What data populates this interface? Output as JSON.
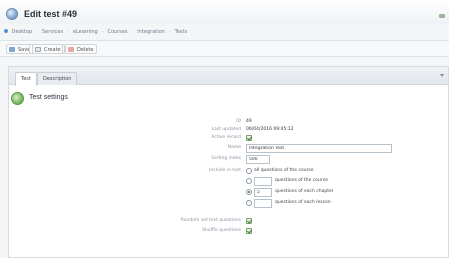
{
  "window": {
    "title": "Edit test #49"
  },
  "breadcrumb": [
    "Desktop",
    "Services",
    "eLearning",
    "Courses",
    "Integration",
    "Tests"
  ],
  "toolbar": {
    "save_label": "Save",
    "create_label": "Create",
    "delete_label": "Delete"
  },
  "tabs": [
    {
      "label": "Test"
    },
    {
      "label": "Description"
    }
  ],
  "section": {
    "title": "Test settings"
  },
  "form": {
    "id_label": "ID",
    "id_value": "49",
    "last_updated_label": "Last updated",
    "last_updated_value": "06/04/2016 09:45:12",
    "active_label": "Active record",
    "active_checked": true,
    "name_label": "Name",
    "name_value": "Integration Test",
    "sort_label": "Sorting index",
    "sort_value": "500",
    "include_label": "Include in test",
    "include_options": [
      {
        "text": "all questions of the course",
        "checked": false,
        "has_input": false,
        "input_value": ""
      },
      {
        "text": "questions of the course",
        "checked": false,
        "has_input": true,
        "input_value": ""
      },
      {
        "text": "questions of each chapter",
        "checked": true,
        "has_input": true,
        "input_value": "5"
      },
      {
        "text": "questions of each lesson",
        "checked": false,
        "has_input": true,
        "input_value": ""
      }
    ],
    "random_label": "Random set test questions",
    "random_checked": true,
    "shuffle_label": "Shuffle questions",
    "shuffle_checked": true
  },
  "colors": {
    "accent_green": "#5d9a4c",
    "border": "#d5dbe0",
    "background_blue": "#dbe9f4"
  }
}
